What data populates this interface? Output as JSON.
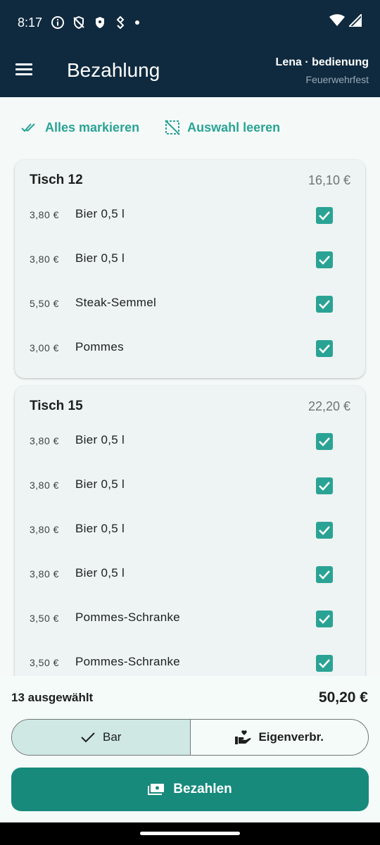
{
  "status": {
    "time": "8:17"
  },
  "app": {
    "title": "Bezahlung",
    "user": "Lena · bedienung",
    "event": "Feuerwehrfest"
  },
  "actions": {
    "select_all": "Alles markieren",
    "clear": "Auswahl leeren"
  },
  "tables": [
    {
      "title": "Tisch 12",
      "total": "16,10 €",
      "items": [
        {
          "price": "3,80 €",
          "name": "Bier 0,5 l",
          "checked": true
        },
        {
          "price": "3,80 €",
          "name": "Bier 0,5 l",
          "checked": true
        },
        {
          "price": "5,50 €",
          "name": "Steak-Semmel",
          "checked": true
        },
        {
          "price": "3,00 €",
          "name": "Pommes",
          "checked": true
        }
      ]
    },
    {
      "title": "Tisch 15",
      "total": "22,20 €",
      "items": [
        {
          "price": "3,80 €",
          "name": "Bier 0,5 l",
          "checked": true
        },
        {
          "price": "3,80 €",
          "name": "Bier 0,5 l",
          "checked": true
        },
        {
          "price": "3,80 €",
          "name": "Bier 0,5 l",
          "checked": true
        },
        {
          "price": "3,80 €",
          "name": "Bier 0,5 l",
          "checked": true
        },
        {
          "price": "3,50 €",
          "name": "Pommes-Schranke",
          "checked": true
        },
        {
          "price": "3,50 €",
          "name": "Pommes-Schranke",
          "checked": true
        }
      ]
    }
  ],
  "summary": {
    "count": "13 ausgewählt",
    "total": "50,20 €"
  },
  "payment_mode": {
    "options": [
      "Bar",
      "Eigenverbr."
    ],
    "selected": "Bar"
  },
  "pay_button": {
    "label": "Bezahlen"
  },
  "colors": {
    "appbar": "#0f2a3f",
    "accent": "#2aa394",
    "primary": "#178a7c"
  }
}
